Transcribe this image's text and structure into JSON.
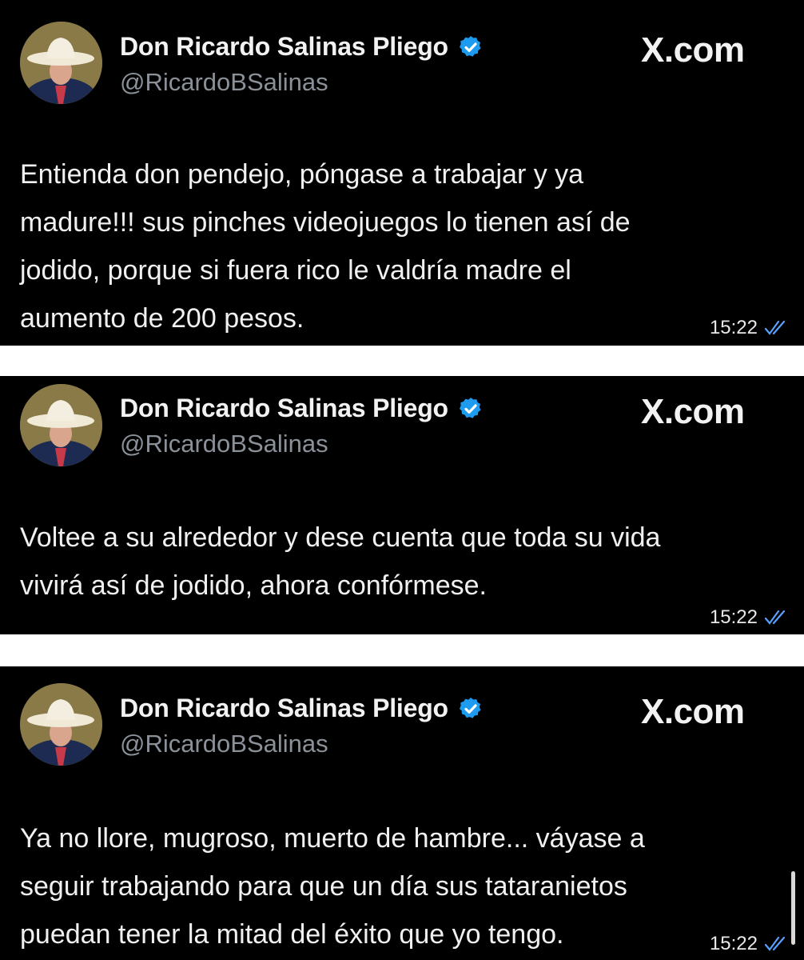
{
  "posts": [
    {
      "author_name": "Don Ricardo Salinas Pliego",
      "handle": "@RicardoBSalinas",
      "brand": "X.com",
      "text": "Entienda don pendejo, póngase a trabajar y ya\nmadure!!! sus pinches videojuegos lo tienen así de\njodido, porque si fuera rico le valdría madre el\naumento de 200 pesos.",
      "time": "15:22"
    },
    {
      "author_name": "Don Ricardo Salinas Pliego",
      "handle": "@RicardoBSalinas",
      "brand": "X.com",
      "text": "Voltee a su alrededor y dese cuenta que toda su vida\nvivirá así de jodido, ahora confórmese.",
      "time": "15:22"
    },
    {
      "author_name": "Don Ricardo Salinas Pliego",
      "handle": "@RicardoBSalinas",
      "brand": "X.com",
      "text": "Ya no llore, mugroso, muerto de hambre... váyase a\nseguir trabajando para que un día sus tataranietos\npuedan tener la mitad del éxito que yo tengo.",
      "time": "15:22"
    }
  ],
  "icons": {
    "verified": "verified-badge-icon",
    "read_receipt": "double-check-icon"
  },
  "colors": {
    "background": "#000000",
    "separator": "#ffffff",
    "verified": "#1d9bf0",
    "handle": "#8b9198",
    "ticks": "#5aa0ff"
  }
}
